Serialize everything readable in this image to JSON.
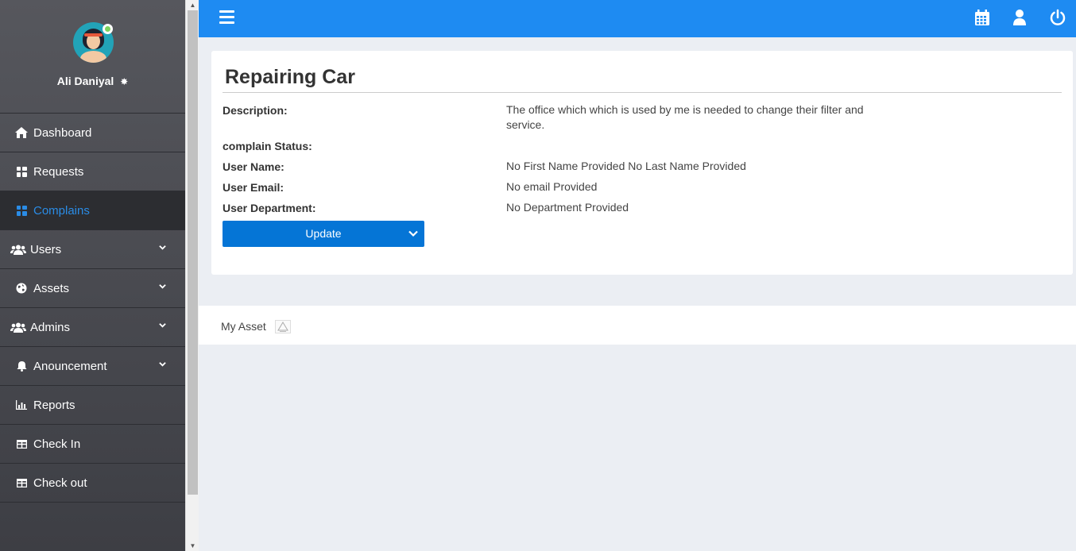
{
  "profile": {
    "name": "Ali Daniyal"
  },
  "sidebar": {
    "items": [
      {
        "label": "Dashboard",
        "icon": "home-icon",
        "expandable": false
      },
      {
        "label": "Requests",
        "icon": "grid-icon",
        "expandable": false
      },
      {
        "label": "Complains",
        "icon": "grid-icon",
        "expandable": false,
        "active": true
      },
      {
        "label": "Users",
        "icon": "users-icon",
        "expandable": true
      },
      {
        "label": "Assets",
        "icon": "globe-icon",
        "expandable": true
      },
      {
        "label": "Admins",
        "icon": "users-icon",
        "expandable": true
      },
      {
        "label": "Anouncement",
        "icon": "bell-icon",
        "expandable": true
      },
      {
        "label": "Reports",
        "icon": "chart-icon",
        "expandable": false
      },
      {
        "label": "Check In",
        "icon": "table-icon",
        "expandable": false
      },
      {
        "label": "Check out",
        "icon": "table-icon",
        "expandable": false
      }
    ]
  },
  "topbar": {
    "icons": [
      "menu-icon",
      "calendar-icon",
      "user-icon",
      "power-icon"
    ],
    "color": "#1e8bf2"
  },
  "complaint": {
    "title": "Repairing Car",
    "fields": [
      {
        "label": "Description:",
        "value": "The office which which is used by me is needed to change their filter and service."
      },
      {
        "label": "complain Status:",
        "value": ""
      },
      {
        "label": "User Name:",
        "value": "No First Name Provided No Last Name Provided"
      },
      {
        "label": "User Email:",
        "value": "No email Provided"
      },
      {
        "label": "User Department:",
        "value": "No Department Provided"
      }
    ],
    "update_label": "Update"
  },
  "asset": {
    "label": "My Asset"
  },
  "colors": {
    "accent": "#1e8bf2",
    "button": "#0575d6",
    "active_nav_text": "#2a8ce6"
  }
}
